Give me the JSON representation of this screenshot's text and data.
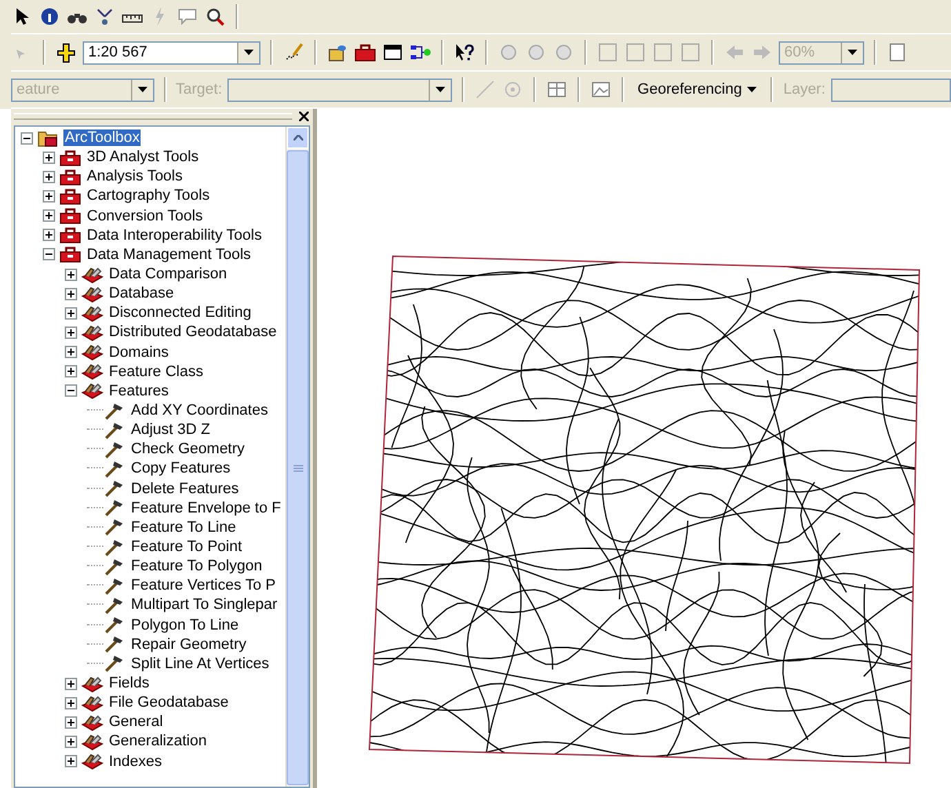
{
  "standard_toolbar": {
    "scale_box": {
      "value": "1:20 567"
    },
    "zoom_box": {
      "value": "60%",
      "disabled": true
    }
  },
  "georeferencing_toolbar": {
    "layer_box": {
      "value": "eature",
      "disabled": true
    },
    "target_label": {
      "text": "Target:",
      "disabled": true
    },
    "menu": {
      "label": "Georeferencing"
    },
    "layer_label": {
      "text": "Layer:",
      "disabled": true
    }
  },
  "arctoolbox": {
    "tree": [
      {
        "label": "ArcToolbox",
        "kind": "root",
        "selected": true,
        "expanded": true,
        "children": [
          {
            "label": "3D Analyst Tools",
            "kind": "toolbox",
            "selected": false,
            "expanded": false
          },
          {
            "label": "Analysis Tools",
            "kind": "toolbox",
            "selected": false,
            "expanded": false
          },
          {
            "label": "Cartography Tools",
            "kind": "toolbox",
            "selected": false,
            "expanded": false
          },
          {
            "label": "Conversion Tools",
            "kind": "toolbox",
            "selected": false,
            "expanded": false
          },
          {
            "label": "Data Interoperability Tools",
            "kind": "toolbox",
            "selected": false,
            "expanded": false
          },
          {
            "label": "Data Management Tools",
            "kind": "toolbox",
            "selected": false,
            "expanded": true,
            "children": [
              {
                "label": "Data Comparison",
                "kind": "toolset",
                "selected": false,
                "expanded": false
              },
              {
                "label": "Database",
                "kind": "toolset",
                "selected": false,
                "expanded": false
              },
              {
                "label": "Disconnected Editing",
                "kind": "toolset",
                "selected": false,
                "expanded": false
              },
              {
                "label": "Distributed Geodatabase",
                "kind": "toolset",
                "selected": false,
                "expanded": false
              },
              {
                "label": "Domains",
                "kind": "toolset",
                "selected": false,
                "expanded": false
              },
              {
                "label": "Feature Class",
                "kind": "toolset",
                "selected": false,
                "expanded": false
              },
              {
                "label": "Features",
                "kind": "toolset",
                "selected": false,
                "expanded": true,
                "children": [
                  {
                    "label": "Add XY Coordinates",
                    "kind": "tool",
                    "selected": false
                  },
                  {
                    "label": "Adjust 3D Z",
                    "kind": "tool",
                    "selected": false
                  },
                  {
                    "label": "Check Geometry",
                    "kind": "tool",
                    "selected": false
                  },
                  {
                    "label": "Copy Features",
                    "kind": "tool",
                    "selected": false
                  },
                  {
                    "label": "Delete Features",
                    "kind": "tool",
                    "selected": false
                  },
                  {
                    "label": "Feature Envelope to F",
                    "kind": "tool",
                    "selected": false
                  },
                  {
                    "label": "Feature To Line",
                    "kind": "tool",
                    "selected": false
                  },
                  {
                    "label": "Feature To Point",
                    "kind": "tool",
                    "selected": false
                  },
                  {
                    "label": "Feature To Polygon",
                    "kind": "tool",
                    "selected": false
                  },
                  {
                    "label": "Feature Vertices To P",
                    "kind": "tool",
                    "selected": false
                  },
                  {
                    "label": "Multipart To Singlepar",
                    "kind": "tool",
                    "selected": false
                  },
                  {
                    "label": "Polygon To Line",
                    "kind": "tool",
                    "selected": false
                  },
                  {
                    "label": "Repair Geometry",
                    "kind": "tool",
                    "selected": false
                  },
                  {
                    "label": "Split Line At Vertices",
                    "kind": "tool",
                    "selected": false
                  }
                ]
              },
              {
                "label": "Fields",
                "kind": "toolset",
                "selected": false,
                "expanded": false
              },
              {
                "label": "File Geodatabase",
                "kind": "toolset",
                "selected": false,
                "expanded": false
              },
              {
                "label": "General",
                "kind": "toolset",
                "selected": false,
                "expanded": false
              },
              {
                "label": "Generalization",
                "kind": "toolset",
                "selected": false,
                "expanded": false
              },
              {
                "label": "Indexes",
                "kind": "toolset",
                "selected": false,
                "expanded": false
              }
            ]
          }
        ]
      }
    ]
  }
}
